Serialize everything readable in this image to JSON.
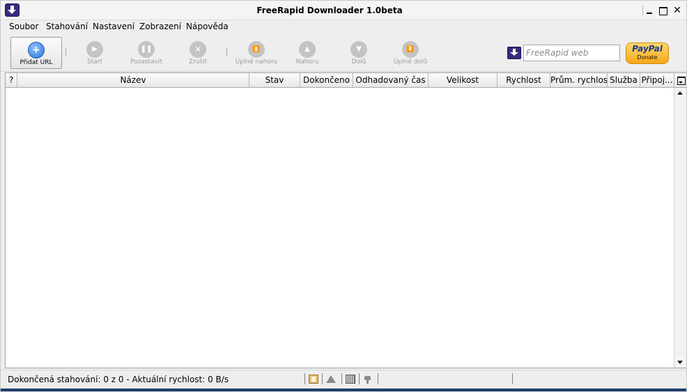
{
  "window": {
    "title": "FreeRapid Downloader 1.0beta",
    "min_glyph": "",
    "max_glyph": "",
    "close_glyph": "✕"
  },
  "menu": [
    {
      "label": "Soubor"
    },
    {
      "label": "Stahování"
    },
    {
      "label": "Nastavení"
    },
    {
      "label": "Zobrazení"
    },
    {
      "label": "Nápověda"
    }
  ],
  "toolbar": {
    "add_url": "Přidat URL",
    "start": "Start",
    "pause": "Pozastavit",
    "cancel": "Zrušit",
    "top": "Úplně nahoru",
    "up": "Nahoru",
    "down": "Dolů",
    "bottom": "Úplně dolů",
    "search_placeholder": "FreeRapid web",
    "paypal_logo": "PayPal",
    "paypal_sub": "Donate"
  },
  "table": {
    "columns": [
      "?",
      "Název",
      "Stav",
      "Dokončeno",
      "Odhadovaný čas",
      "Velikost",
      "Rychlost",
      "Prům. rychlost",
      "Služba",
      "Připoj..."
    ]
  },
  "status": {
    "text": "Dokončená stahování: 0 z 0 - Aktuální rychlost: 0 B/s"
  },
  "colors": {
    "accent": "#3a2a7a",
    "add_button_blue": "#2673d6",
    "paypal_gold": "#f6a81a"
  }
}
